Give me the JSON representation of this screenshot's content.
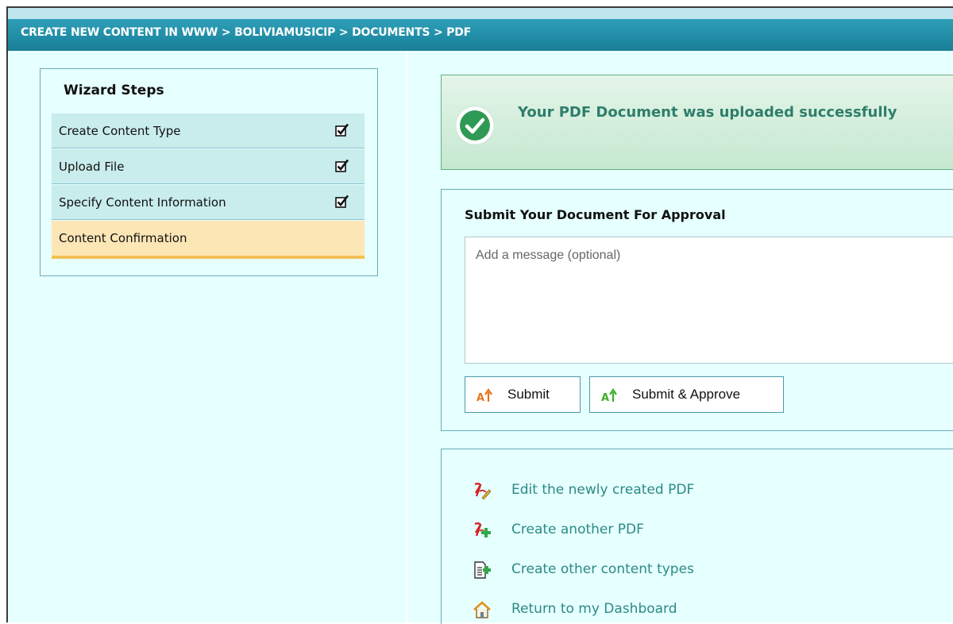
{
  "breadcrumb": "CREATE NEW CONTENT IN WWW > BOLIVIAMUSICIP > DOCUMENTS > PDF",
  "wizard": {
    "title": "Wizard Steps",
    "steps": [
      {
        "label": "Create Content Type",
        "completed": true
      },
      {
        "label": "Upload File",
        "completed": true
      },
      {
        "label": "Specify Content Information",
        "completed": true
      },
      {
        "label": "Content Confirmation",
        "completed": false,
        "current": true
      }
    ]
  },
  "success": {
    "message": "Your PDF Document was uploaded successfully",
    "icon": "check-circle-icon",
    "color": "#2e7e6b"
  },
  "approval": {
    "title": "Submit Your Document For Approval",
    "message_placeholder": "Add a message (optional)",
    "message_value": "",
    "submit_label": "Submit",
    "submit_approve_label": "Submit & Approve"
  },
  "links": [
    {
      "label": "Edit the newly created PDF",
      "icon": "edit-pdf-icon"
    },
    {
      "label": "Create another PDF",
      "icon": "add-pdf-icon"
    },
    {
      "label": "Create other content types",
      "icon": "add-document-icon"
    },
    {
      "label": "Return to my Dashboard",
      "icon": "home-icon"
    }
  ],
  "colors": {
    "header": "#1f8aa3",
    "panel_bg": "#e6ffff",
    "step_bg": "#c9ecec",
    "current_step_bg": "#fde6b5",
    "link": "#2b8a86"
  }
}
